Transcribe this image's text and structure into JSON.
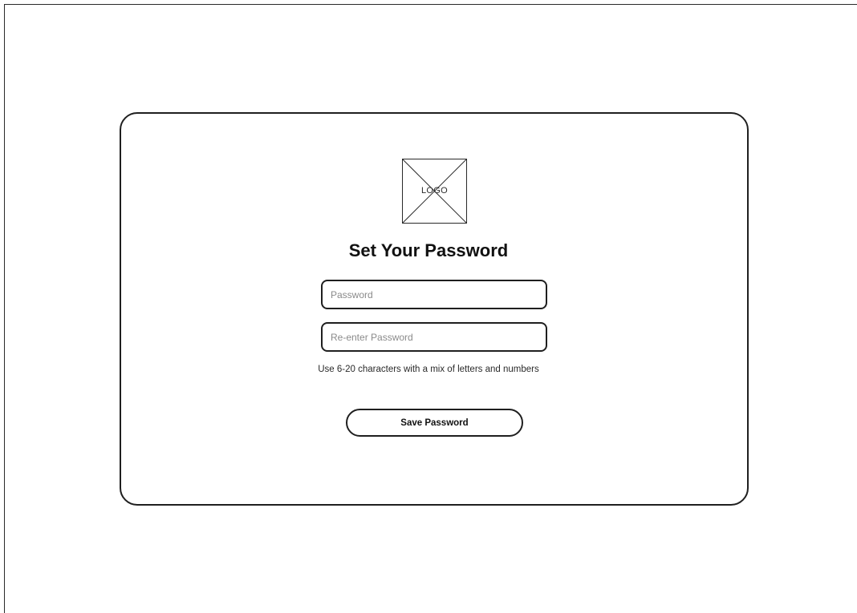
{
  "logo": {
    "label": "LOGO"
  },
  "title": "Set Your Password",
  "fields": {
    "password_placeholder": "Password",
    "reenter_placeholder": "Re-enter Password",
    "password_value": "",
    "reenter_value": ""
  },
  "hint": "Use 6-20 characters with a mix of letters and numbers",
  "save_label": "Save Password",
  "colors": {
    "border": "#1f1f1f",
    "background": "#ffffff",
    "placeholder": "#8a8a8a"
  }
}
